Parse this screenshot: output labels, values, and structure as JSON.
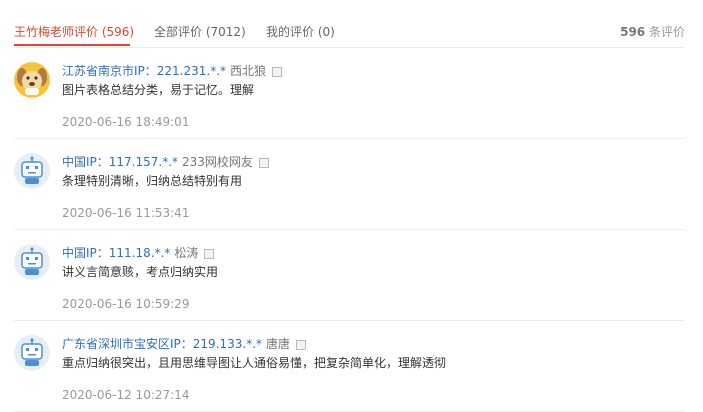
{
  "tabs": [
    {
      "label": "王竹梅老师评价 (596)",
      "active": true
    },
    {
      "label": "全部评价 (7012)",
      "active": false
    },
    {
      "label": "我的评价 (0)",
      "active": false
    }
  ],
  "total": {
    "count": "596",
    "suffix": " 条评价"
  },
  "reviews": [
    {
      "ip": "江苏省南京市IP：221.231.*.*",
      "nick": "西北狼",
      "content": "图片表格总结分类，易于记忆。理解",
      "time": "2020-06-16 18:49:01",
      "avatar": "dog"
    },
    {
      "ip": "中国IP：117.157.*.*",
      "nick": "233网校网友",
      "content": "条理特别清晰，归纳总结特别有用",
      "time": "2020-06-16 11:53:41",
      "avatar": "robot"
    },
    {
      "ip": "中国IP：111.18.*.*",
      "nick": "松涛",
      "content": "讲义言简意赅，考点归纳实用",
      "time": "2020-06-16 10:59:29",
      "avatar": "robot"
    },
    {
      "ip": "广东省深圳市宝安区IP：219.133.*.*",
      "nick": "唐唐",
      "content": "重点归纳很突出，且用思维导图让人通俗易懂，把复杂简单化，理解透彻",
      "time": "2020-06-12 10:27:14",
      "avatar": "robot"
    }
  ],
  "colors": {
    "accent": "#e2462d",
    "link": "#2e6fbf",
    "muted": "#999999"
  }
}
